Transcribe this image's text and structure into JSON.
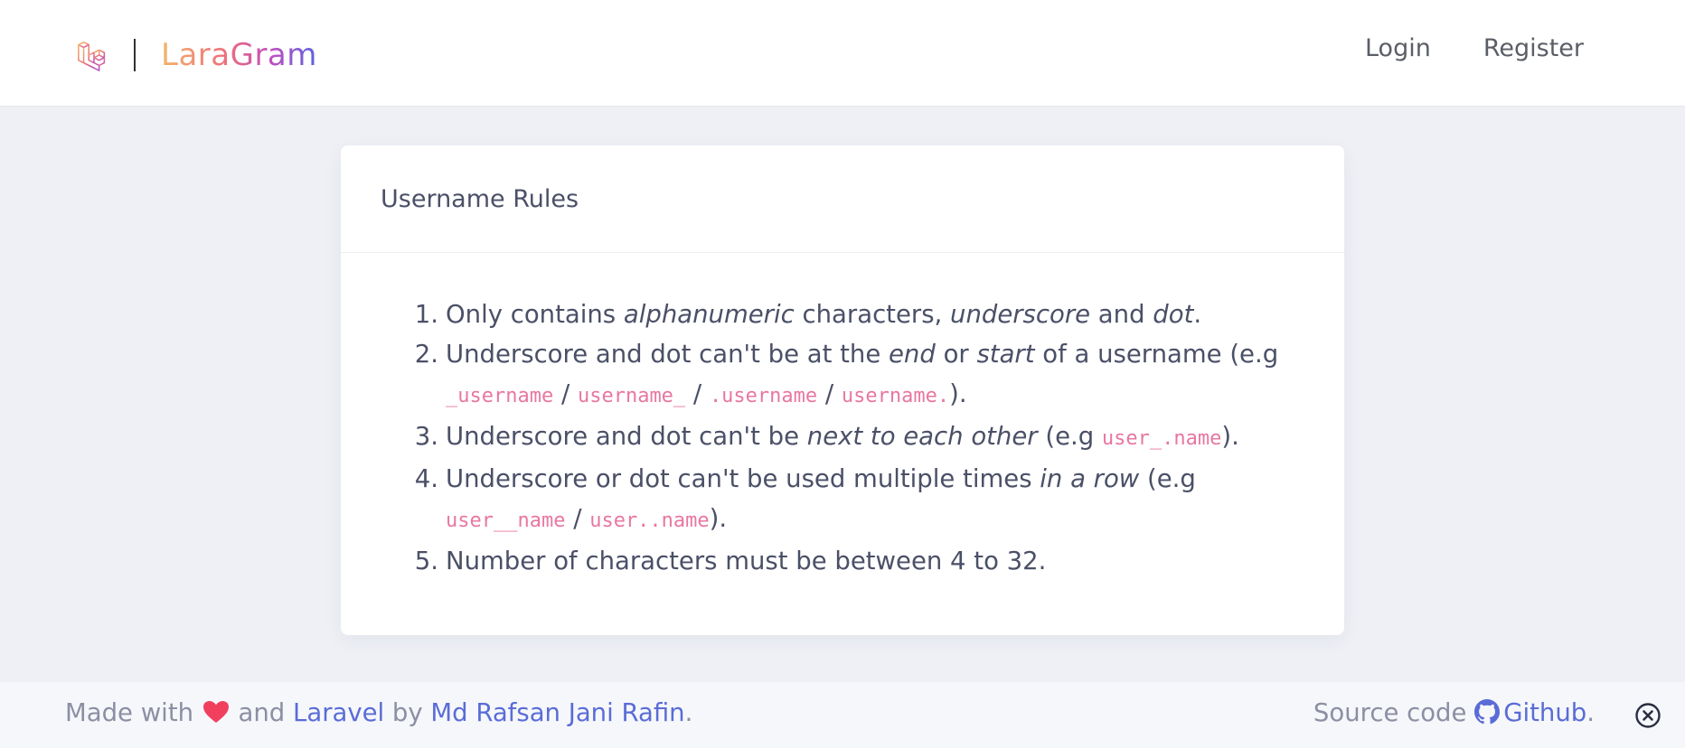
{
  "navbar": {
    "brand_name": "LaraGram",
    "login": "Login",
    "register": "Register"
  },
  "card": {
    "title": "Username Rules"
  },
  "rules": [
    {
      "num": "1.",
      "p1": "Only contains ",
      "em1": "alphanumeric",
      "p2": " characters, ",
      "em2": "underscore",
      "p3": " and ",
      "em3": "dot",
      "p4": "."
    },
    {
      "num": "2.",
      "p1": "Underscore and dot can't be at the ",
      "em1": "end",
      "p2": " or ",
      "em2": "start",
      "p3": " of a username (e.g ",
      "code1": "_username",
      "s1": " / ",
      "code2": "username_",
      "s2": " / ",
      "code3": ".username",
      "s3": " / ",
      "code4": "username.",
      "p4": ")."
    },
    {
      "num": "3.",
      "p1": "Underscore and dot can't be ",
      "em1": "next to each other",
      "p2": " (e.g ",
      "code1": "user_.name",
      "p3": ")."
    },
    {
      "num": "4.",
      "p1": "Underscore or dot can't be used multiple times ",
      "em1": "in a row",
      "p2": " (e.g ",
      "code1": "user__name",
      "s1": " / ",
      "code2": "user..name",
      "p3": ")."
    },
    {
      "num": "5.",
      "p1": "Number of characters must be between 4 to 32."
    }
  ],
  "footer": {
    "made_with": "Made with ",
    "and": " and ",
    "laravel": "Laravel",
    "by": " by ",
    "author": "Md Rafsan Jani Rafin",
    "period": ".",
    "source_code": "Source code ",
    "github": "Github",
    "period2": "."
  },
  "colors": {
    "heart": "#f0405e",
    "link": "#5a6cd6",
    "code": "#e877a1"
  },
  "icons": {
    "logo": "laravel-logo-icon",
    "heart": "heart-icon",
    "github": "github-icon",
    "close": "close-circle-icon"
  }
}
